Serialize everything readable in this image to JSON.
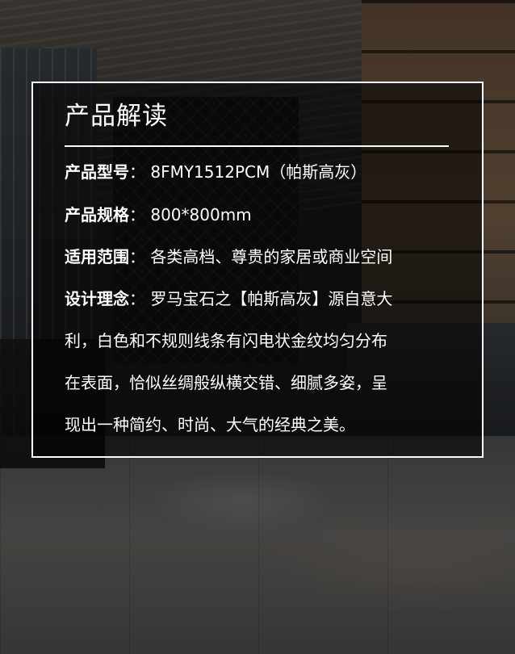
{
  "title": "产品解读",
  "specs": {
    "model": {
      "label": "产品型号",
      "value": "：  8FMY1512PCM（帕斯高灰）"
    },
    "size": {
      "label": "产品规格",
      "value": "：  800*800mm"
    },
    "scope": {
      "label": "适用范围",
      "value": "：  各类高档、尊贵的家居或商业空间"
    },
    "concept": {
      "label": "设计理念",
      "lines": [
        "：  罗马宝石之【帕斯高灰】源自意大",
        "利，白色和不规则线条有闪电状金纹均匀分布",
        "在表面，恰似丝绸般纵横交错、细腻多姿，呈",
        "现出一种简约、时尚、大气的经典之美。"
      ]
    }
  }
}
